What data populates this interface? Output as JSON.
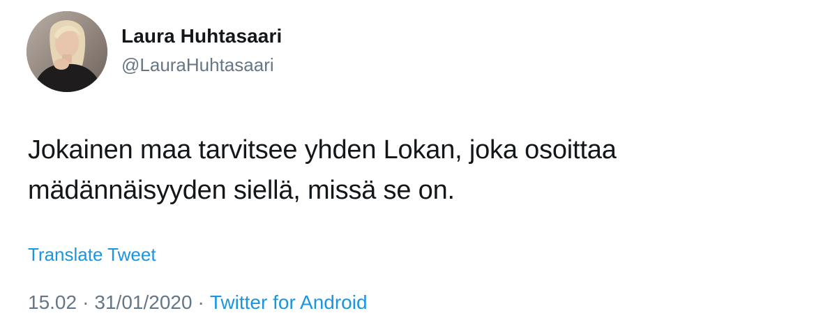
{
  "author": {
    "display_name": "Laura Huhtasaari",
    "handle": "@LauraHuhtasaari"
  },
  "tweet": {
    "text_lines": [
      "Jokainen maa tarvitsee yhden Lokan, joka osoittaa",
      "mädännäisyyden siellä, missä se on."
    ],
    "translate_label": "Translate Tweet"
  },
  "meta": {
    "time": "15.02",
    "separator": "·",
    "date": "31/01/2020",
    "source": "Twitter for Android"
  },
  "colors": {
    "text": "#14171a",
    "secondary": "#657786",
    "link": "#1b95e0",
    "background": "#ffffff"
  }
}
